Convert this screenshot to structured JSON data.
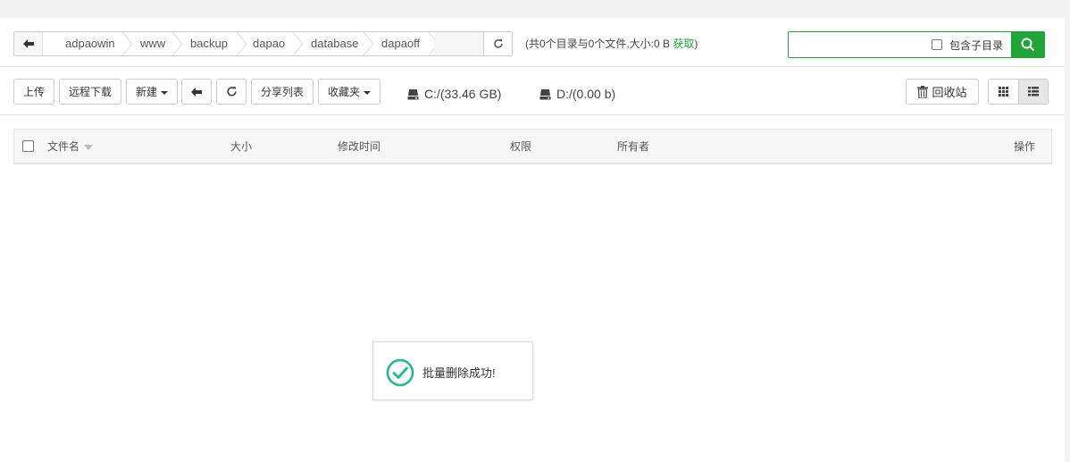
{
  "pathbar": {
    "crumbs": [
      "adpaowin",
      "www",
      "backup",
      "dapao",
      "database",
      "dapaoff"
    ],
    "summary_text": "(共0个目录与0个文件,大小:0 B ",
    "fetch_label": "获取",
    "summary_close": ")"
  },
  "search": {
    "placeholder": "",
    "include_subdir_label": "包含子目录"
  },
  "toolbar": {
    "upload": "上传",
    "remote_download": "远程下载",
    "new": "新建",
    "share_list": "分享列表",
    "favorites": "收藏夹",
    "recycle_bin": "回收站"
  },
  "disks": [
    {
      "label": "C:/(33.46 GB)"
    },
    {
      "label": "D:/(0.00 b)"
    }
  ],
  "table": {
    "columns": {
      "filename": "文件名",
      "size": "大小",
      "mtime": "修改时间",
      "permission": "权限",
      "owner": "所有者",
      "actions": "操作"
    }
  },
  "toast": {
    "message": "批量删除成功!"
  },
  "colors": {
    "accent": "#20a53a",
    "toast_check": "#1fb888"
  }
}
